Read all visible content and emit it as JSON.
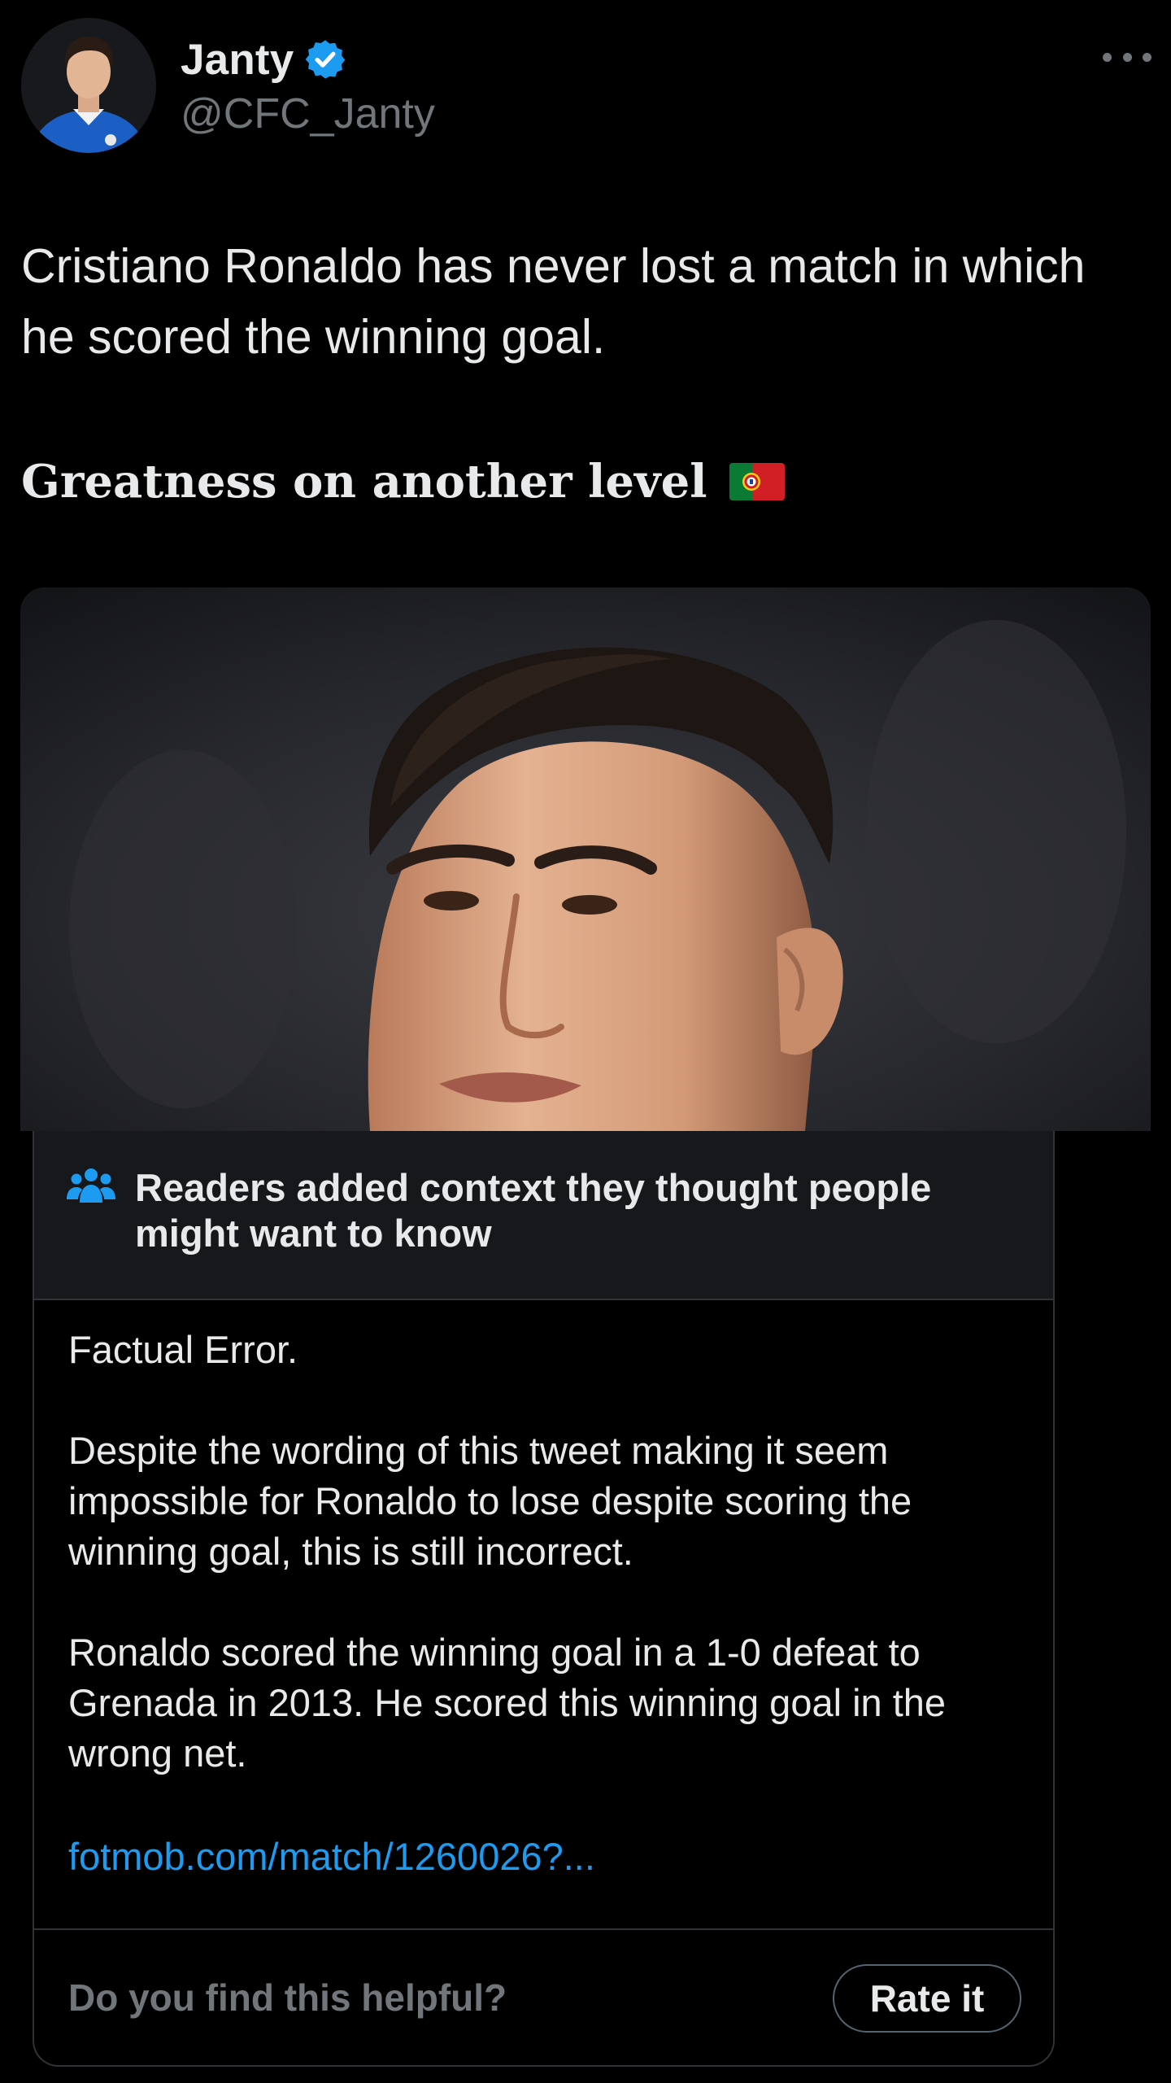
{
  "author": {
    "display_name": "Janty",
    "handle": "@CFC_Janty",
    "avatar_icon": "profile-photo",
    "verified_icon": "verified-badge-icon",
    "verified_color": "#1d9bf0"
  },
  "tweet": {
    "text": "Cristiano Ronaldo has never lost a match in which he scored the winning goal.",
    "emphasis": "Greatness on another level",
    "emoji_icon": "portugal-flag-icon",
    "media_icon": "player-portrait-photo"
  },
  "community_note": {
    "title": "Readers added context they thought people might want to know",
    "icon": "people-icon",
    "paragraphs": [
      "Factual Error.",
      "Despite the wording of this tweet making it seem impossible for Ronaldo to lose despite scoring the winning goal, this is still incorrect.",
      "Ronaldo scored the winning goal in a 1-0 defeat to Grenada in 2013. He scored this winning goal in the wrong net."
    ],
    "link": "fotmob.com/match/1260026?...",
    "footer_question": "Do you find this helpful?",
    "rate_label": "Rate it"
  },
  "colors": {
    "background": "#000000",
    "text": "#e7e9ea",
    "muted": "#71767b",
    "accent": "#1d9bf0",
    "note_header": "#16181c",
    "border": "#2f3336"
  }
}
